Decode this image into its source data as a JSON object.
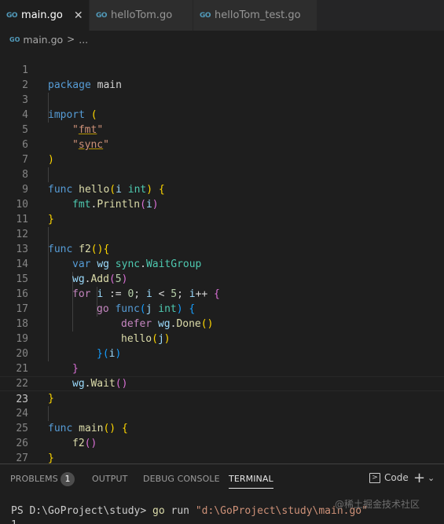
{
  "tabs": [
    {
      "icon": "go-icon",
      "label": "main.go",
      "active": true,
      "close": "✕"
    },
    {
      "icon": "go-icon",
      "label": "helloTom.go",
      "active": false
    },
    {
      "icon": "go-icon",
      "label": "helloTom_test.go",
      "active": false
    }
  ],
  "breadcrumb": {
    "file": "main.go",
    "sep": ">",
    "more": "..."
  },
  "line_numbers": [
    "1",
    "2",
    "3",
    "4",
    "5",
    "6",
    "7",
    "8",
    "9",
    "10",
    "11",
    "12",
    "13",
    "14",
    "15",
    "16",
    "17",
    "18",
    "19",
    "20",
    "21",
    "22",
    "23",
    "24",
    "25",
    "26",
    "27"
  ],
  "code": {
    "l1": [
      "package",
      " main"
    ],
    "l3": [
      "import",
      " ",
      "("
    ],
    "l4": [
      "\"",
      "fmt",
      "\""
    ],
    "l5": [
      "\"",
      "sync",
      "\""
    ],
    "l6": [
      ")"
    ],
    "l8": [
      "func",
      " ",
      "hello",
      "(",
      "i",
      " ",
      "int",
      ")",
      " ",
      "{"
    ],
    "l9": [
      "fmt",
      ".",
      "Println",
      "(",
      "i",
      ")"
    ],
    "l10": [
      "}"
    ],
    "l12": [
      "func",
      " ",
      "f2",
      "()",
      "{"
    ],
    "l13": [
      "var",
      " ",
      "wg",
      " ",
      "sync",
      ".",
      "WaitGroup"
    ],
    "l14": [
      "wg",
      ".",
      "Add",
      "(",
      "5",
      ")"
    ],
    "l15": [
      "for",
      " ",
      "i",
      " := ",
      "0",
      "; ",
      "i",
      " < ",
      "5",
      "; ",
      "i",
      "++ ",
      "{"
    ],
    "l16": [
      "go",
      " ",
      "func",
      "(",
      "j",
      " ",
      "int",
      ")",
      " ",
      "{"
    ],
    "l17": [
      "defer",
      " ",
      "wg",
      ".",
      "Done",
      "()"
    ],
    "l18": [
      "hello",
      "(",
      "j",
      ")"
    ],
    "l19": [
      "}",
      "(",
      "i",
      ")"
    ],
    "l20": [
      "}"
    ],
    "l21": [
      "wg",
      ".",
      "Wait",
      "()"
    ],
    "l22": [
      "}"
    ],
    "l24": [
      "func",
      " ",
      "main",
      "()",
      " ",
      "{"
    ],
    "l25": [
      "f2",
      "()"
    ],
    "l26": [
      "}"
    ]
  },
  "panel": {
    "problems": "PROBLEMS",
    "problems_count": "1",
    "output": "OUTPUT",
    "debug_console": "DEBUG CONSOLE",
    "terminal": "TERMINAL",
    "shell_label": "Code",
    "shell_icon": ">",
    "add": "+",
    "chevron": "⌄"
  },
  "terminal": {
    "prompt": "PS D:\\GoProject\\study> ",
    "cmd": "go",
    "sub": " run ",
    "arg": "\"d:\\GoProject\\study\\main.go\"",
    "output_first": "1"
  },
  "watermark": "@稀土掘金技术社区"
}
